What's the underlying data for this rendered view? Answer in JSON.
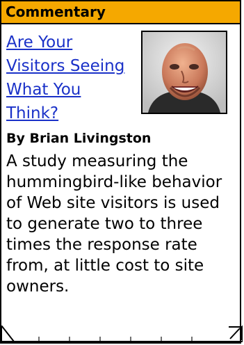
{
  "header": {
    "title": "Commentary",
    "bg_color": "#f5a800"
  },
  "article": {
    "headline": "Are Your Visitors Seeing What You Think?",
    "byline": "By Brian Livingston",
    "summary": "A study measuring the hummingbird-like behavior of Web site visitors is used to generate two to three times the response rate from, at little cost to site owners.",
    "link_color": "#1a31c8"
  },
  "icons": {
    "author_photo": "author-photo-icon",
    "page_curl": "page-curl-icon"
  }
}
